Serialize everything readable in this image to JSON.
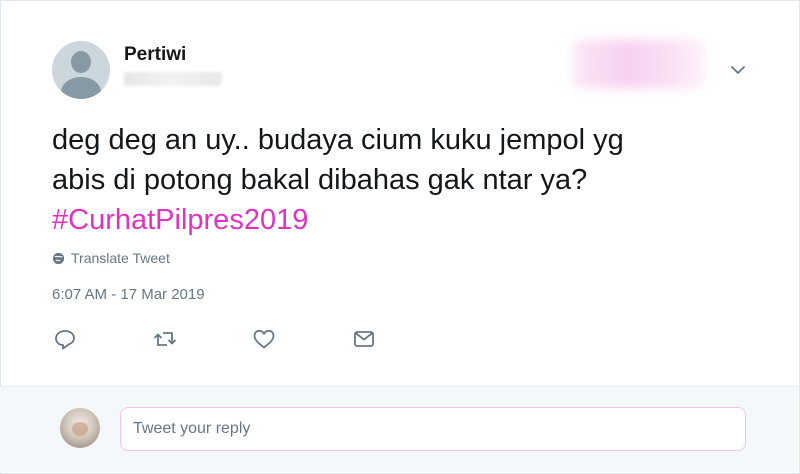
{
  "tweet": {
    "author_name": "Pertiwi",
    "text_lines": [
      "deg deg an uy.. budaya cium kuku jempol yg",
      "abis di potong bakal dibahas gak ntar ya?"
    ],
    "hashtag": "#CurhatPilpres2019",
    "translate_label": "Translate Tweet",
    "timestamp": "6:07 AM - 17 Mar 2019"
  },
  "actions": {
    "icons": [
      "reply-icon",
      "retweet-icon",
      "like-icon",
      "direct-message-icon"
    ]
  },
  "reply": {
    "placeholder": "Tweet your reply"
  },
  "colors": {
    "hashtag": "#e033c2",
    "muted_text": "#657786",
    "icon": "#657786",
    "reply_bar_bg": "#f5f8fa",
    "reply_input_border": "#f3c4ea"
  }
}
